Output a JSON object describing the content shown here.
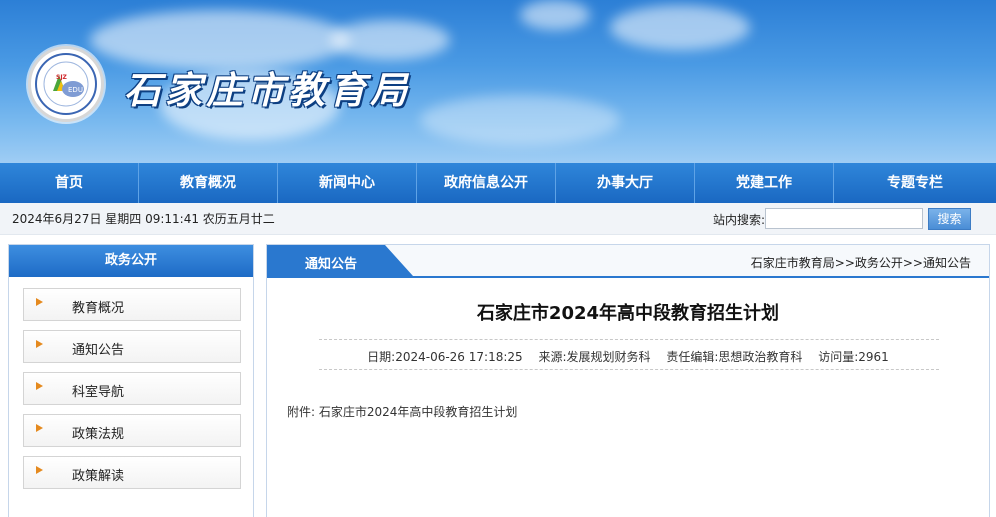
{
  "site": {
    "title": "石家庄市教育局",
    "logo_icon": "sjz-education-logo-icon"
  },
  "nav": {
    "items": [
      {
        "label": "首页"
      },
      {
        "label": "教育概况"
      },
      {
        "label": "新闻中心"
      },
      {
        "label": "政府信息公开"
      },
      {
        "label": "办事大厅"
      },
      {
        "label": "党建工作"
      },
      {
        "label": "专题专栏"
      }
    ]
  },
  "datebar": {
    "date_text": "2024年6月27日 星期四 09:11:41 农历五月廿二",
    "search_label": "站内搜索:",
    "search_value": "",
    "search_button": "搜索"
  },
  "sidebar": {
    "title": "政务公开",
    "items": [
      {
        "label": "教育概况"
      },
      {
        "label": "通知公告"
      },
      {
        "label": "科室导航"
      },
      {
        "label": "政策法规"
      },
      {
        "label": "政策解读"
      }
    ],
    "accent_color": "#e58a1f"
  },
  "main": {
    "tab_label": "通知公告",
    "breadcrumb": "石家庄市教育局>>政务公开>>通知公告",
    "article": {
      "title": "石家庄市2024年高中段教育招生计划",
      "date": "日期:2024-06-26 17:18:25",
      "source": "来源:发展规划财务科",
      "editor": "责任编辑:思想政治教育科",
      "views": "访问量:2961",
      "attachment_label": "附件:",
      "attachment_link": "石家庄市2024年高中段教育招生计划"
    }
  },
  "colors": {
    "nav_blue": "#1a68c2",
    "banner_blue": "#2c7fd6"
  }
}
